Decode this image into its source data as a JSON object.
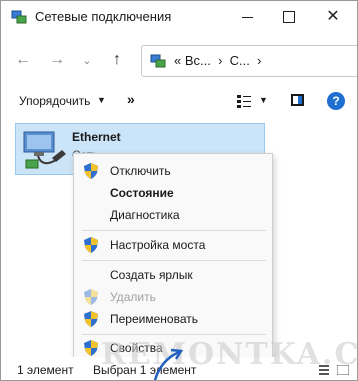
{
  "window": {
    "title": "Сетевые подключения",
    "close_glyph": "✕"
  },
  "nav": {
    "back_glyph": "←",
    "forward_glyph": "→",
    "dropdown_glyph": "⌄",
    "up_glyph": "↑",
    "address": "« Вс...  ›  С...  ›"
  },
  "toolbar": {
    "sort_label": "Упорядочить",
    "sort_caret": "▼",
    "more_label": "»",
    "view_caret": "▼",
    "help_label": "?"
  },
  "item": {
    "name": "Ethernet",
    "subtitle": "Сеть"
  },
  "menu": {
    "items": [
      {
        "label": "Отключить",
        "shield": true,
        "bold": false,
        "disabled": false
      },
      {
        "label": "Состояние",
        "shield": false,
        "bold": true,
        "disabled": false
      },
      {
        "label": "Диагностика",
        "shield": false,
        "bold": false,
        "disabled": false
      },
      {
        "label": "Настройка моста",
        "shield": true,
        "bold": false,
        "disabled": false
      },
      {
        "label": "Создать ярлык",
        "shield": false,
        "bold": false,
        "disabled": false
      },
      {
        "label": "Удалить",
        "shield": true,
        "bold": false,
        "disabled": true
      },
      {
        "label": "Переименовать",
        "shield": true,
        "bold": false,
        "disabled": false
      },
      {
        "label": "Свойства",
        "shield": true,
        "bold": false,
        "disabled": false
      }
    ]
  },
  "status": {
    "count": "1 элемент",
    "selected": "Выбран 1 элемент"
  },
  "watermark": "REMONTKA.COM",
  "colors": {
    "selection": "#cce4f7",
    "accent": "#1f6fd1",
    "arrow": "#1f5fbf"
  }
}
